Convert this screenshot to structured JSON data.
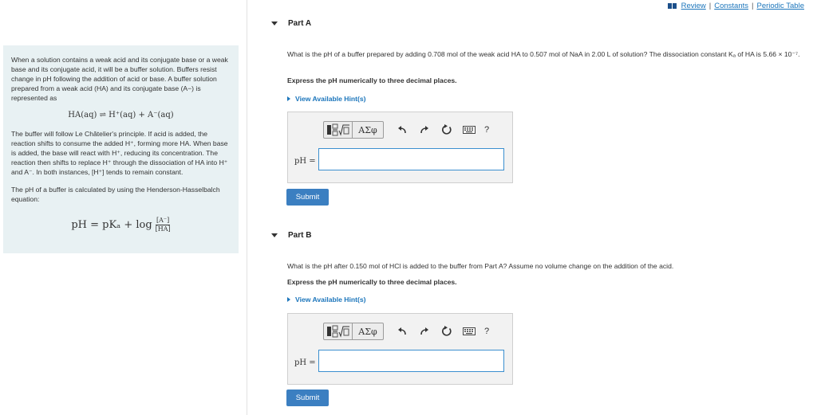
{
  "top_links": {
    "review": "Review",
    "constants": "Constants",
    "periodic_table": "Periodic Table",
    "separator": "|"
  },
  "intro": {
    "para1": "When a solution contains a weak acid and its conjugate base or a weak base and its conjugate acid, it will be a buffer solution. Buffers resist change in pH following the addition of acid or base. A buffer solution prepared from a weak acid (HA) and its conjugate base (A−) is represented as",
    "equilibrium": "HA(aq) ⇌ H⁺(aq) + A⁻(aq)",
    "para2": "The buffer will follow Le Châtelier's principle. If acid is added, the reaction shifts to consume the added H⁺, forming more HA. When base is added, the base will react with H⁺, reducing its concentration. The reaction then shifts to replace H⁺ through the dissociation of HA into H⁺ and A⁻. In both instances, [H⁺] tends to remain constant.",
    "para3": "The pH of a buffer is calculated by using the Henderson-Hasselbalch equation:",
    "hh_lhs": "pH = pKₐ + log",
    "hh_num": "[A⁻]",
    "hh_den": "[HA]"
  },
  "part_a": {
    "title": "Part A",
    "question": "What is the pH of a buffer prepared by adding 0.708 mol of the weak acid HA to 0.507 mol of NaA in 2.00 L of solution? The dissociation constant Kₐ of HA is 5.66 × 10⁻⁷.",
    "instruction": "Express the pH numerically to three decimal places.",
    "hint": "View Available Hint(s)",
    "answer_label": "pH =",
    "answer_value": "",
    "submit": "Submit"
  },
  "part_b": {
    "title": "Part B",
    "question": "What is the pH after 0.150 mol of HCl is added to the buffer from Part A? Assume no volume change on the addition of the acid.",
    "instruction": "Express the pH numerically to three decimal places.",
    "hint": "View Available Hint(s)",
    "answer_label": "pH =",
    "answer_value": "",
    "submit": "Submit"
  },
  "toolbar": {
    "greek": "ΑΣφ",
    "help": "?"
  },
  "icons": [
    "review-icon",
    "templates-icon",
    "greek-symbols-icon",
    "undo-icon",
    "redo-icon",
    "reset-icon",
    "keyboard-icon",
    "help-icon",
    "expand-triangle-icon",
    "hint-arrow-icon"
  ],
  "colors": {
    "link": "#1b75bb",
    "submit": "#3b7fc1",
    "intro_bg": "#e8f1f3",
    "input_border": "#3b8fcf"
  }
}
